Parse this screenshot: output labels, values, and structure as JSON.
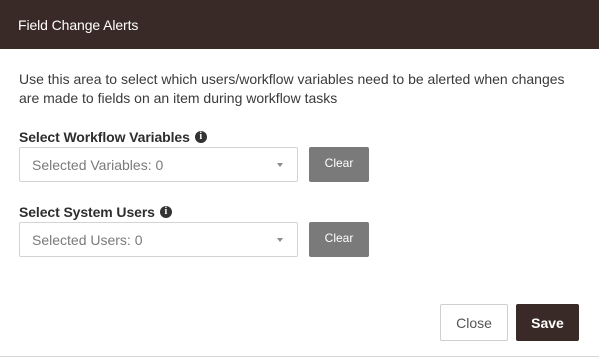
{
  "header": {
    "title": "Field Change Alerts"
  },
  "description": "Use this area to select which users/workflow variables need to be alerted when changes are made to fields on an item during workflow tasks",
  "workflow_variables": {
    "label": "Select Workflow Variables",
    "info_icon": "info-circle-icon",
    "select_text": "Selected Variables: 0",
    "clear_label": "Clear"
  },
  "system_users": {
    "label": "Select System Users",
    "info_icon": "info-circle-icon",
    "select_text": "Selected Users: 0",
    "clear_label": "Clear"
  },
  "footer": {
    "close_label": "Close",
    "save_label": "Save"
  },
  "colors": {
    "header_bg": "#3a2a27",
    "clear_button_bg": "#7a7a7a",
    "save_button_bg": "#3a2a27"
  }
}
